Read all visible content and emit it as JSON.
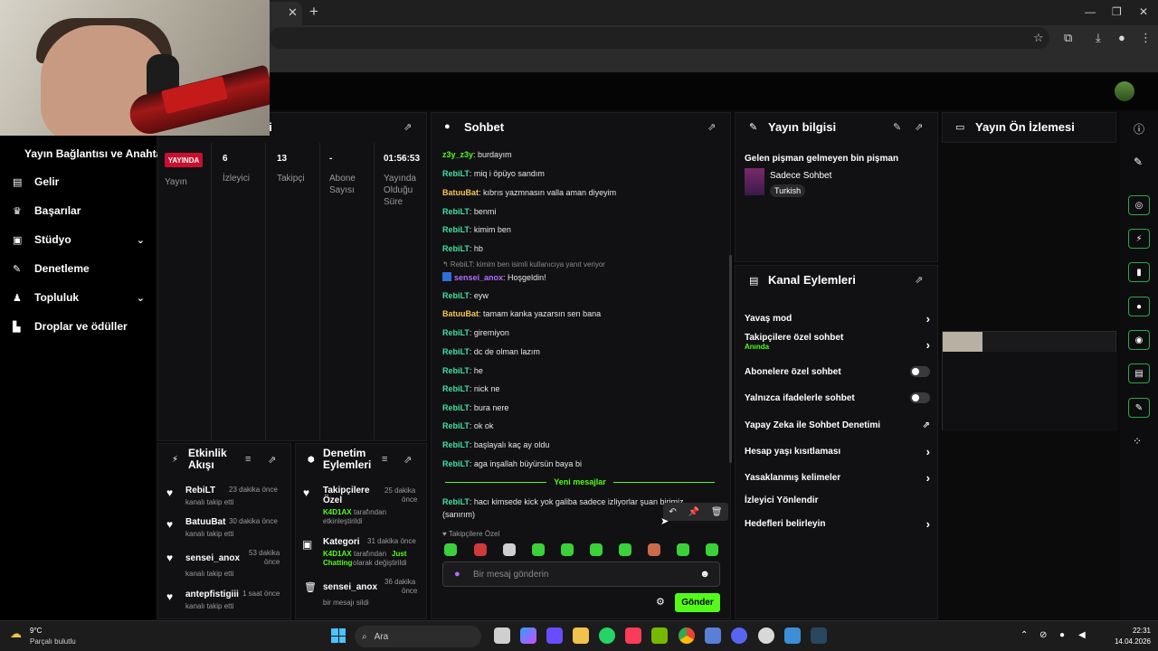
{
  "browser": {
    "tab_close": "✕",
    "new_tab": "+",
    "window_controls": [
      "—",
      "❐",
      "✕"
    ]
  },
  "sidebar": {
    "title": "Yayın Bağlantısı ve Anahtarı",
    "items": [
      {
        "label": "Gelir",
        "icon": "chart-icon"
      },
      {
        "label": "Başarılar",
        "icon": "trophy-icon"
      },
      {
        "label": "Stüdyo",
        "icon": "studio-icon",
        "expandable": true
      },
      {
        "label": "Denetleme",
        "icon": "wrench-icon"
      },
      {
        "label": "Topluluk",
        "icon": "community-icon",
        "expandable": true
      },
      {
        "label": "Droplar ve ödüller",
        "icon": "drops-icon"
      }
    ]
  },
  "stats": {
    "title_fragment": "eri",
    "live_badge": "YAYINDA",
    "live_label": "Yayın",
    "viewers_value": "6",
    "viewers_label": "İzleyici",
    "followers_value": "13",
    "followers_label": "Takipçi",
    "subs_value": "-",
    "subs_label_1": "Abone",
    "subs_label_2": "Sayısı",
    "uptime_value": "01:56:53",
    "uptime_label_1": "Yayında",
    "uptime_label_2": "Olduğu",
    "uptime_label_3": "Süre"
  },
  "activity": {
    "title_1": "Etkinlik",
    "title_2": "Akışı",
    "events": [
      {
        "user": "RebiLT",
        "time": "23 dakika önce",
        "action": "kanalı takip etti"
      },
      {
        "user": "BatuuBat",
        "time": "30 dakika önce",
        "action": "kanalı takip etti"
      },
      {
        "user": "sensei_anox",
        "time_1": "53 dakika",
        "time_2": "önce",
        "action": "kanalı takip etti"
      },
      {
        "user": "antepfistigiii",
        "time": "1 saat önce",
        "action": "kanalı takip etti"
      }
    ]
  },
  "moderation": {
    "title_1": "Denetim",
    "title_2": "Eylemleri",
    "items": [
      {
        "title_1": "Takipçilere",
        "title_2": "Özel",
        "time_1": "25 dakika",
        "time_2": "önce",
        "actor": "K4D1AX",
        "desc_1": "tarafından",
        "desc_2": "etkinleştirildi"
      },
      {
        "title_1": "Kategori",
        "time": "31 dakika önce",
        "actor": "K4D1AX",
        "desc_1": "tarafından",
        "highlight": "Just",
        "highlight_2": "Chatting",
        "desc_2": "olarak değiştirildi"
      },
      {
        "title_1": "sensei_anox",
        "time_1": "36 dakika",
        "time_2": "önce",
        "desc_1": "bir mesajı sildi"
      }
    ]
  },
  "chat": {
    "title": "Sohbet",
    "messages": [
      {
        "user": "z3y_z3y",
        "color": "c-green",
        "text": " burdayım"
      },
      {
        "user": "RebiLT",
        "color": "c-teal",
        "text": " miq i öpüyo sandım"
      },
      {
        "user": "BatuuBat",
        "color": "c-yellow",
        "text": " kıbrıs yazmnasın valla aman diyeyim"
      },
      {
        "user": "RebiLT",
        "color": "c-teal",
        "text": " benmi"
      },
      {
        "user": "RebiLT",
        "color": "c-teal",
        "text": " kimim ben"
      },
      {
        "user": "RebiLT",
        "color": "c-teal",
        "text": " hb"
      }
    ],
    "reply_note": "↰ RebiLT: kimim ben isimli kullanıcıya yanıt veriyor",
    "reply_message": {
      "user": "sensei_anox",
      "color": "c-purple",
      "text": " Hoşgeldin!"
    },
    "messages_2": [
      {
        "user": "RebiLT",
        "color": "c-teal",
        "text": " eyw"
      },
      {
        "user": "BatuuBat",
        "color": "c-yellow",
        "text": " tamam kanka yazarsın sen bana"
      },
      {
        "user": "RebiLT",
        "color": "c-teal",
        "text": " giremiyon"
      },
      {
        "user": "RebiLT",
        "color": "c-teal",
        "text": " dc de olman lazım"
      },
      {
        "user": "RebiLT",
        "color": "c-teal",
        "text": " he"
      },
      {
        "user": "RebiLT",
        "color": "c-teal",
        "text": " nick ne"
      },
      {
        "user": "RebiLT",
        "color": "c-teal",
        "text": " bura nere"
      },
      {
        "user": "RebiLT",
        "color": "c-teal",
        "text": " ok ok"
      },
      {
        "user": "RebiLT",
        "color": "c-teal",
        "text": " başlayalı kaç ay oldu"
      },
      {
        "user": "RebiLT",
        "color": "c-teal",
        "text": " aga inşallah büyürsün baya bi"
      }
    ],
    "new_messages": "Yeni mesajlar",
    "last_message": {
      "user": "RebiLT",
      "text_1": " hacı kimsede kick yok galiba sadece izliyorlar şuan birimiz",
      "text_2": "(sanırım)"
    },
    "followers_only": "Takipçilere Özel",
    "input_placeholder": "Bir mesaj gönderin",
    "send_label": "Gönder"
  },
  "stream_info": {
    "title": "Yayın bilgisi",
    "stream_title": "Gelen pişman gelmeyen bin pişman",
    "category": "Sadece Sohbet",
    "language": "Turkish"
  },
  "channel_actions": {
    "title": "Kanal Eylemleri",
    "rows": [
      {
        "label": "Yavaş mod",
        "type": "chevron"
      },
      {
        "label": "Takipçilere özel sohbet",
        "sub": "Anında",
        "type": "chevron"
      },
      {
        "label": "Abonelere özel sohbet",
        "type": "toggle"
      },
      {
        "label": "Yalnızca ifadelerle sohbet",
        "type": "toggle"
      },
      {
        "label": "Yapay Zeka ile Sohbet Denetimi",
        "type": "external"
      },
      {
        "label": "Hesap yaşı kısıtlaması",
        "type": "chevron"
      },
      {
        "label": "Yasaklanmış kelimeler",
        "type": "chevron"
      },
      {
        "label": "İzleyici Yönlendir",
        "type": "none"
      },
      {
        "label": "Hedefleri belirleyin",
        "type": "chevron"
      }
    ]
  },
  "preview": {
    "title": "Yayın Ön İzlemesi"
  },
  "taskbar": {
    "weather_temp": "9°C",
    "weather_desc": "Parçalı bulutlu",
    "search_label": "Ara",
    "time": "22:31",
    "date": "14.04.2026"
  },
  "colors": {
    "accent": "#53fc18",
    "live_red": "#c8102e",
    "panel_bg": "#111113"
  }
}
